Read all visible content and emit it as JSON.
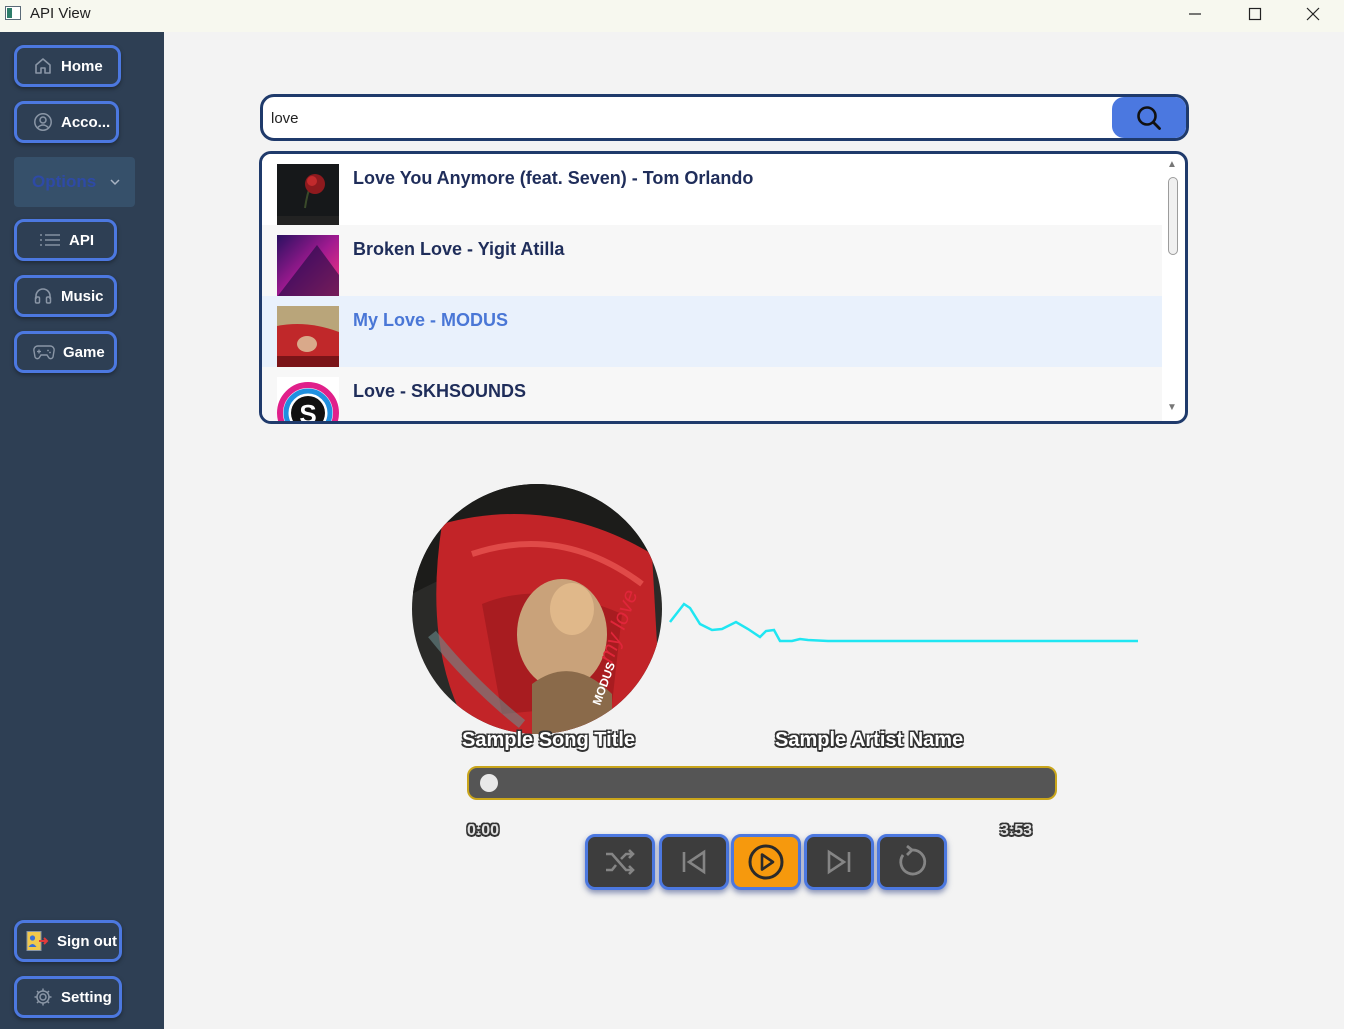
{
  "window": {
    "title": "API View"
  },
  "sidebar": {
    "home_label": "Home",
    "account_label": "Acco...",
    "options_label": "Options",
    "api_label": "API",
    "music_label": "Music",
    "game_label": "Game",
    "signout_label": "Sign out",
    "setting_label": "Setting"
  },
  "search": {
    "value": "love"
  },
  "results": [
    {
      "label": "Love You Anymore (feat. Seven) - Tom Orlando"
    },
    {
      "label": "Broken Love - Yigit Atilla"
    },
    {
      "label": "My Love - MODUS"
    },
    {
      "label": "Love - SKHSOUNDS"
    }
  ],
  "player": {
    "song_title": "Sample Song Title",
    "artist_name": "Sample Artist Name",
    "current_time": "0:00",
    "total_time": "3:53",
    "progress_fraction": 0.0
  },
  "colors": {
    "sidebar_bg": "#2e3f54",
    "accent_blue": "#4c78e0",
    "play_orange": "#f6990d",
    "wave_cyan": "#1fe6f2",
    "progress_border": "#c9a51b"
  },
  "icons": {
    "search": "magnifier-icon",
    "home": "home-icon",
    "account": "user-circle-icon",
    "api": "list-icon",
    "music": "headphones-icon",
    "game": "gamepad-icon",
    "signout": "sign-out-icon",
    "setting": "gear-icon",
    "shuffle": "shuffle-icon",
    "previous": "skip-previous-icon",
    "play": "play-circle-icon",
    "next": "skip-next-icon",
    "repeat": "repeat-icon"
  }
}
